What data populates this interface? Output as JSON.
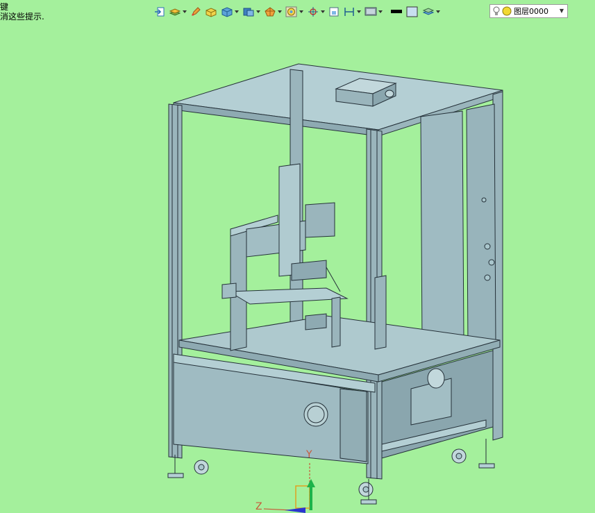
{
  "hint": {
    "line1": "键",
    "line2": "消这些提示."
  },
  "toolbar": {
    "items": [
      {
        "name": "import-icon",
        "has_menu": false
      },
      {
        "name": "layers-stack-icon",
        "has_menu": true
      },
      {
        "name": "pencil-icon",
        "has_menu": false
      },
      {
        "name": "box-yellow-icon",
        "has_menu": false
      },
      {
        "name": "cube-icon",
        "has_menu": true
      },
      {
        "name": "view-cube-icon",
        "has_menu": true
      },
      {
        "name": "shading-icon",
        "has_menu": true
      },
      {
        "name": "target-icon",
        "has_menu": true
      },
      {
        "name": "snap-icon",
        "has_menu": true
      },
      {
        "name": "frame-icon",
        "has_menu": false
      },
      {
        "name": "dimension-icon",
        "has_menu": true
      },
      {
        "name": "display-icon",
        "has_menu": true
      },
      {
        "name": "line-color-icon",
        "has_menu": false
      },
      {
        "name": "fill-color-icon",
        "has_menu": false
      },
      {
        "name": "layer-props-icon",
        "has_menu": true
      }
    ]
  },
  "layer_select": {
    "value": "图层0000"
  },
  "axis": {
    "y_label": "Y",
    "z_label": "Z"
  },
  "colors": {
    "background": "#a4f09c",
    "part": "#a9c6cc",
    "edge": "#243038"
  }
}
